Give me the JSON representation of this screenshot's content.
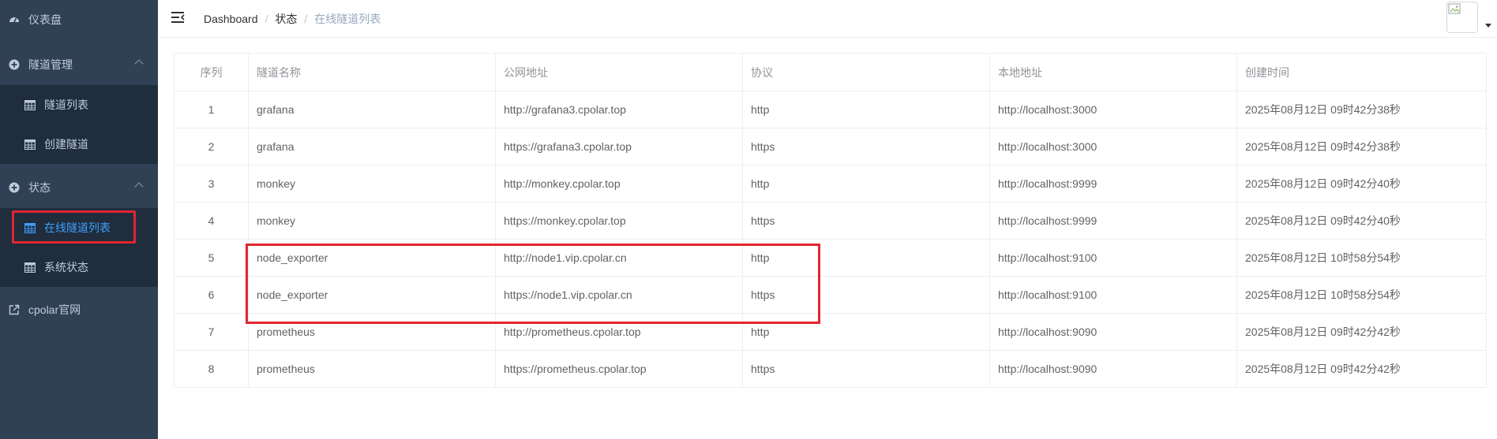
{
  "sidebar": {
    "items": [
      {
        "label": "仪表盘",
        "icon": "dashboard-icon"
      },
      {
        "label": "隧道管理",
        "icon": "plus-circle-icon",
        "expanded": true,
        "children": [
          {
            "label": "隧道列表",
            "icon": "table-icon"
          },
          {
            "label": "创建隧道",
            "icon": "table-icon"
          }
        ]
      },
      {
        "label": "状态",
        "icon": "plus-circle-icon",
        "expanded": true,
        "children": [
          {
            "label": "在线隧道列表",
            "icon": "table-icon",
            "active": true
          },
          {
            "label": "系统状态",
            "icon": "table-icon"
          }
        ]
      },
      {
        "label": "cpolar官网",
        "icon": "external-link-icon"
      }
    ]
  },
  "breadcrumb": [
    "Dashboard",
    "状态",
    "在线隧道列表"
  ],
  "colors": {
    "sidebar_bg": "#304156",
    "submenu_bg": "#1f2d3d",
    "active": "#409eff",
    "highlight": "#e3262f"
  },
  "table": {
    "headers": [
      "序列",
      "隧道名称",
      "公网地址",
      "协议",
      "本地地址",
      "创建时间"
    ],
    "rows": [
      [
        "1",
        "grafana",
        "http://grafana3.cpolar.top",
        "http",
        "http://localhost:3000",
        "2025年08月12日 09时42分38秒"
      ],
      [
        "2",
        "grafana",
        "https://grafana3.cpolar.top",
        "https",
        "http://localhost:3000",
        "2025年08月12日 09时42分38秒"
      ],
      [
        "3",
        "monkey",
        "http://monkey.cpolar.top",
        "http",
        "http://localhost:9999",
        "2025年08月12日 09时42分40秒"
      ],
      [
        "4",
        "monkey",
        "https://monkey.cpolar.top",
        "https",
        "http://localhost:9999",
        "2025年08月12日 09时42分40秒"
      ],
      [
        "5",
        "node_exporter",
        "http://node1.vip.cpolar.cn",
        "http",
        "http://localhost:9100",
        "2025年08月12日 10时58分54秒"
      ],
      [
        "6",
        "node_exporter",
        "https://node1.vip.cpolar.cn",
        "https",
        "http://localhost:9100",
        "2025年08月12日 10时58分54秒"
      ],
      [
        "7",
        "prometheus",
        "http://prometheus.cpolar.top",
        "http",
        "http://localhost:9090",
        "2025年08月12日 09时42分42秒"
      ],
      [
        "8",
        "prometheus",
        "https://prometheus.cpolar.top",
        "https",
        "http://localhost:9090",
        "2025年08月12日 09时42分42秒"
      ]
    ]
  }
}
